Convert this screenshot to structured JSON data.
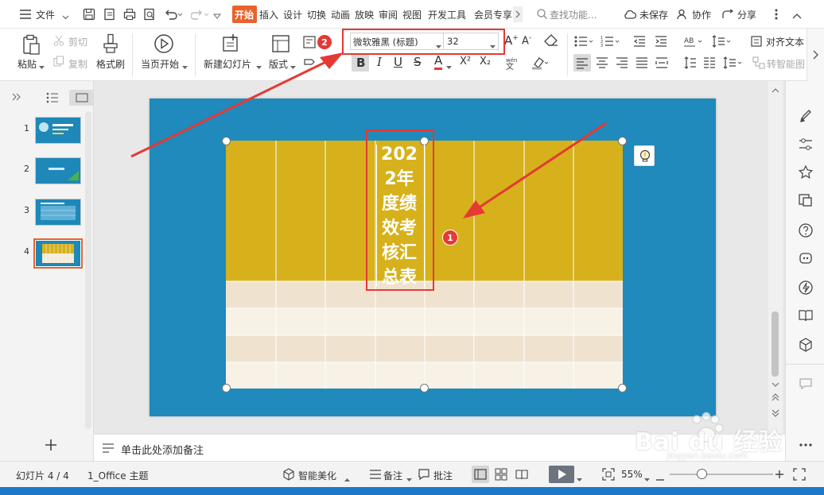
{
  "menubar": {
    "file_label": "文件",
    "tabs": [
      "开始",
      "插入",
      "设计",
      "切换",
      "动画",
      "放映",
      "审阅",
      "视图",
      "开发工具",
      "会员专享"
    ],
    "search_placeholder": "查找功能...",
    "unsaved_label": "未保存",
    "collab_label": "协作",
    "share_label": "分享"
  },
  "ribbon": {
    "paste_label": "粘贴",
    "cut_label": "剪切",
    "copy_label": "复制",
    "format_painter_label": "格式刷",
    "from_current_label": "当页开始",
    "new_slide_label": "新建幻灯片",
    "layout_label": "版式",
    "reset_label": "重置",
    "section_label": "节",
    "font_name": "微软雅黑 (标题)",
    "font_size": "32",
    "bold": "B",
    "italic": "I",
    "underline": "U",
    "strike": "S",
    "font_color": "A",
    "superscript": "X²",
    "subscript": "X₂",
    "align_text_label": "对齐文本",
    "convert_smartart_label": "转智能图"
  },
  "thumbnails": {
    "numbers": [
      "1",
      "2",
      "3",
      "4"
    ]
  },
  "slide": {
    "title_chars": [
      "202",
      "2年",
      "度绩",
      "效考",
      "核汇",
      "总表"
    ],
    "cols": 8
  },
  "annotations": {
    "badge1": "1",
    "badge2": "2"
  },
  "notes": {
    "placeholder": "单击此处添加备注"
  },
  "statusbar": {
    "slide_info": "幻灯片 4 / 4",
    "theme": "1_Office 主题",
    "beautify": "智能美化",
    "notes": "备注",
    "comments": "批注",
    "zoom": "55%"
  },
  "watermark": {
    "brand": "Bai du 经验",
    "url": "jingyan.baidu.com"
  },
  "colors": {
    "accent_tab": "#e8622c",
    "slide_bg": "#1f8abb",
    "table_header": "#d6b11b",
    "row_a": "#efe3cf",
    "row_b": "#f7f1e6",
    "annotation_red": "#e53935"
  }
}
